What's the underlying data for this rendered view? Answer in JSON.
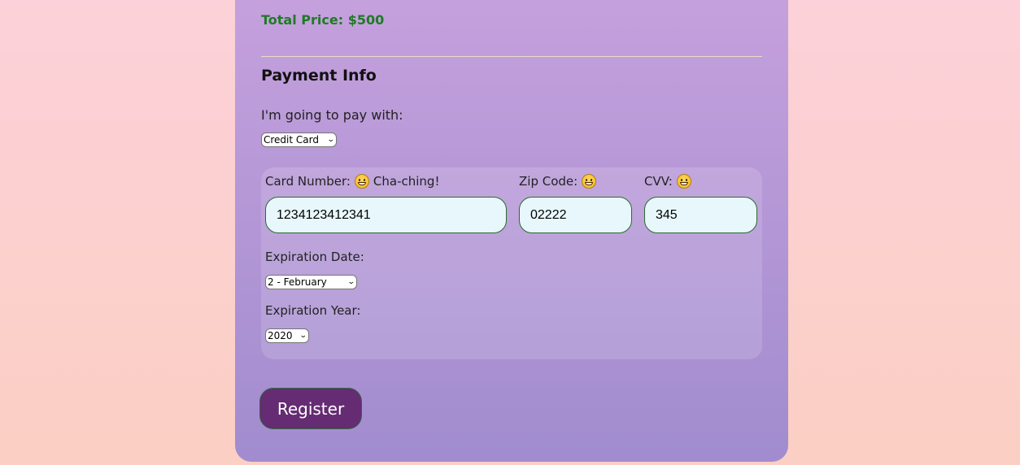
{
  "order": {
    "total_price": "Total Price: $500"
  },
  "payment": {
    "section_title": "Payment Info",
    "method_label": "I'm going to pay with:",
    "method_selected": "Credit Card",
    "card_number_label": "Card Number:",
    "card_number_hint": "Cha-ching!",
    "card_number_value": "1234123412341",
    "zip_label": "Zip Code:",
    "zip_value": "02222",
    "cvv_label": "CVV:",
    "cvv_value": "345",
    "exp_date_label": "Expiration Date:",
    "exp_date_selected": "2 - February",
    "exp_year_label": "Expiration Year:",
    "exp_year_selected": "2020"
  },
  "actions": {
    "register_label": "Register"
  },
  "icons": {
    "validation": "grinning-face-icon"
  },
  "colors": {
    "total_price": "#1f7a25",
    "register_button": "#652b73",
    "input_background": "#e8f7fb",
    "input_border": "#2a6a31"
  }
}
